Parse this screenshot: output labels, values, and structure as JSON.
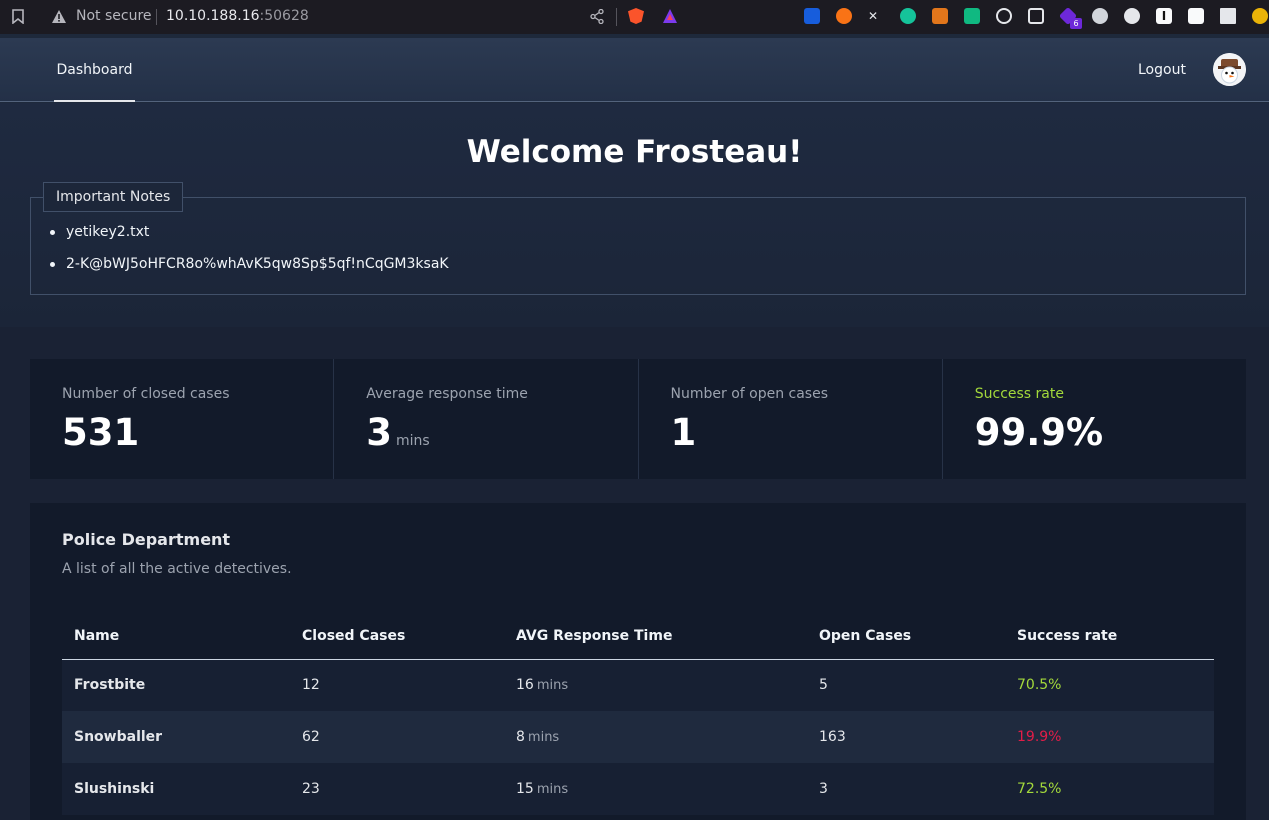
{
  "browser": {
    "security_label": "Not secure",
    "url_host": "10.10.188.16",
    "url_port": ":50628",
    "extension_badge": "6"
  },
  "nav": {
    "tab_dashboard": "Dashboard",
    "logout": "Logout"
  },
  "hero": {
    "welcome": "Welcome Frosteau!",
    "notes_title": "Important Notes",
    "notes": [
      "yetikey2.txt",
      "2-K@bWJ5oHFCR8o%whAvK5qw8Sp$5qf!nCqGM3ksaK"
    ]
  },
  "stats": [
    {
      "label": "Number of closed cases",
      "value": "531",
      "unit": ""
    },
    {
      "label": "Average response time",
      "value": "3",
      "unit": "mins"
    },
    {
      "label": "Number of open cases",
      "value": "1",
      "unit": ""
    },
    {
      "label": "Success rate",
      "value": "99.9%",
      "unit": ""
    }
  ],
  "colors": {
    "accent_green": "#a3d93b",
    "danger_red": "#e11d48"
  },
  "department": {
    "title": "Police Department",
    "subtitle": "A list of all the active detectives.",
    "columns": [
      "Name",
      "Closed Cases",
      "AVG Response Time",
      "Open Cases",
      "Success rate"
    ],
    "unit": "mins",
    "rows": [
      {
        "name": "Frostbite",
        "closed": "12",
        "avg": "16",
        "open": "5",
        "rate": "70.5%",
        "status": "good"
      },
      {
        "name": "Snowballer",
        "closed": "62",
        "avg": "8",
        "open": "163",
        "rate": "19.9%",
        "status": "bad"
      },
      {
        "name": "Slushinski",
        "closed": "23",
        "avg": "15",
        "open": "3",
        "rate": "72.5%",
        "status": "good"
      }
    ]
  }
}
